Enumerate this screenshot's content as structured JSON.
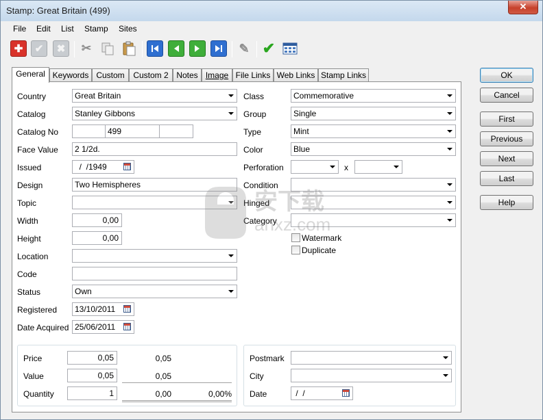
{
  "window": {
    "title": "Stamp: Great Britain (499)",
    "close_glyph": "✕"
  },
  "menu": [
    {
      "label": "File"
    },
    {
      "label": "Edit"
    },
    {
      "label": "List"
    },
    {
      "label": "Stamp"
    },
    {
      "label": "Sites"
    }
  ],
  "toolbar": {
    "icons": [
      "add-icon",
      "check-disabled-icon",
      "delete-disabled-icon",
      "cut-icon",
      "copy-icon",
      "paste-icon",
      "first-record-icon",
      "previous-record-icon",
      "next-record-icon",
      "last-record-icon",
      "edit-icon",
      "accept-icon",
      "grid-icon"
    ]
  },
  "tabs": [
    {
      "label": "General",
      "active": true
    },
    {
      "label": "Keywords"
    },
    {
      "label": "Custom"
    },
    {
      "label": "Custom 2"
    },
    {
      "label": "Notes"
    },
    {
      "label": "Image"
    },
    {
      "label": "File Links"
    },
    {
      "label": "Web Links"
    },
    {
      "label": "Stamp Links"
    }
  ],
  "left": {
    "country": {
      "label": "Country",
      "value": "Great Britain"
    },
    "catalog": {
      "label": "Catalog",
      "value": "Stanley Gibbons"
    },
    "catalog_no": {
      "label": "Catalog No",
      "prefix": "",
      "value": "499",
      "suffix": ""
    },
    "face_value": {
      "label": "Face Value",
      "value": "2 1/2d."
    },
    "issued": {
      "label": "Issued",
      "value": "  /  /1949"
    },
    "design": {
      "label": "Design",
      "value": "Two Hemispheres"
    },
    "topic": {
      "label": "Topic",
      "value": ""
    },
    "width": {
      "label": "Width",
      "value": "0,00"
    },
    "height": {
      "label": "Height",
      "value": "0,00"
    },
    "location": {
      "label": "Location",
      "value": ""
    },
    "code": {
      "label": "Code",
      "value": ""
    },
    "status": {
      "label": "Status",
      "value": "Own"
    },
    "registered": {
      "label": "Registered",
      "value": "13/10/2011"
    },
    "date_acquired": {
      "label": "Date Acquired",
      "value": "25/06/2011"
    }
  },
  "right": {
    "class": {
      "label": "Class",
      "value": "Commemorative"
    },
    "group": {
      "label": "Group",
      "value": "Single"
    },
    "type": {
      "label": "Type",
      "value": "Mint"
    },
    "color": {
      "label": "Color",
      "value": "Blue"
    },
    "perforation": {
      "label": "Perforation",
      "value1": "",
      "separator": "x",
      "value2": ""
    },
    "condition": {
      "label": "Condition",
      "value": ""
    },
    "hinged": {
      "label": "Hinged",
      "value": ""
    },
    "category": {
      "label": "Category",
      "value": ""
    },
    "watermark": {
      "label": "Watermark",
      "checked": false
    },
    "duplicate": {
      "label": "Duplicate",
      "checked": false
    }
  },
  "pricing": {
    "price": {
      "label": "Price",
      "value": "0,05",
      "total": "0,05"
    },
    "value": {
      "label": "Value",
      "value": "0,05",
      "total": "0,05"
    },
    "quantity": {
      "label": "Quantity",
      "value": "1",
      "total": "0,00",
      "percent": "0,00%"
    }
  },
  "postmark": {
    "postmark": {
      "label": "Postmark",
      "value": ""
    },
    "city": {
      "label": "City",
      "value": ""
    },
    "date": {
      "label": "Date",
      "value": " /  /"
    }
  },
  "buttons": {
    "ok": "OK",
    "cancel": "Cancel",
    "first": "First",
    "previous": "Previous",
    "next": "Next",
    "last": "Last",
    "help": "Help"
  },
  "watermark_brand": {
    "text": "安下载",
    "sub": "anxz.com"
  }
}
